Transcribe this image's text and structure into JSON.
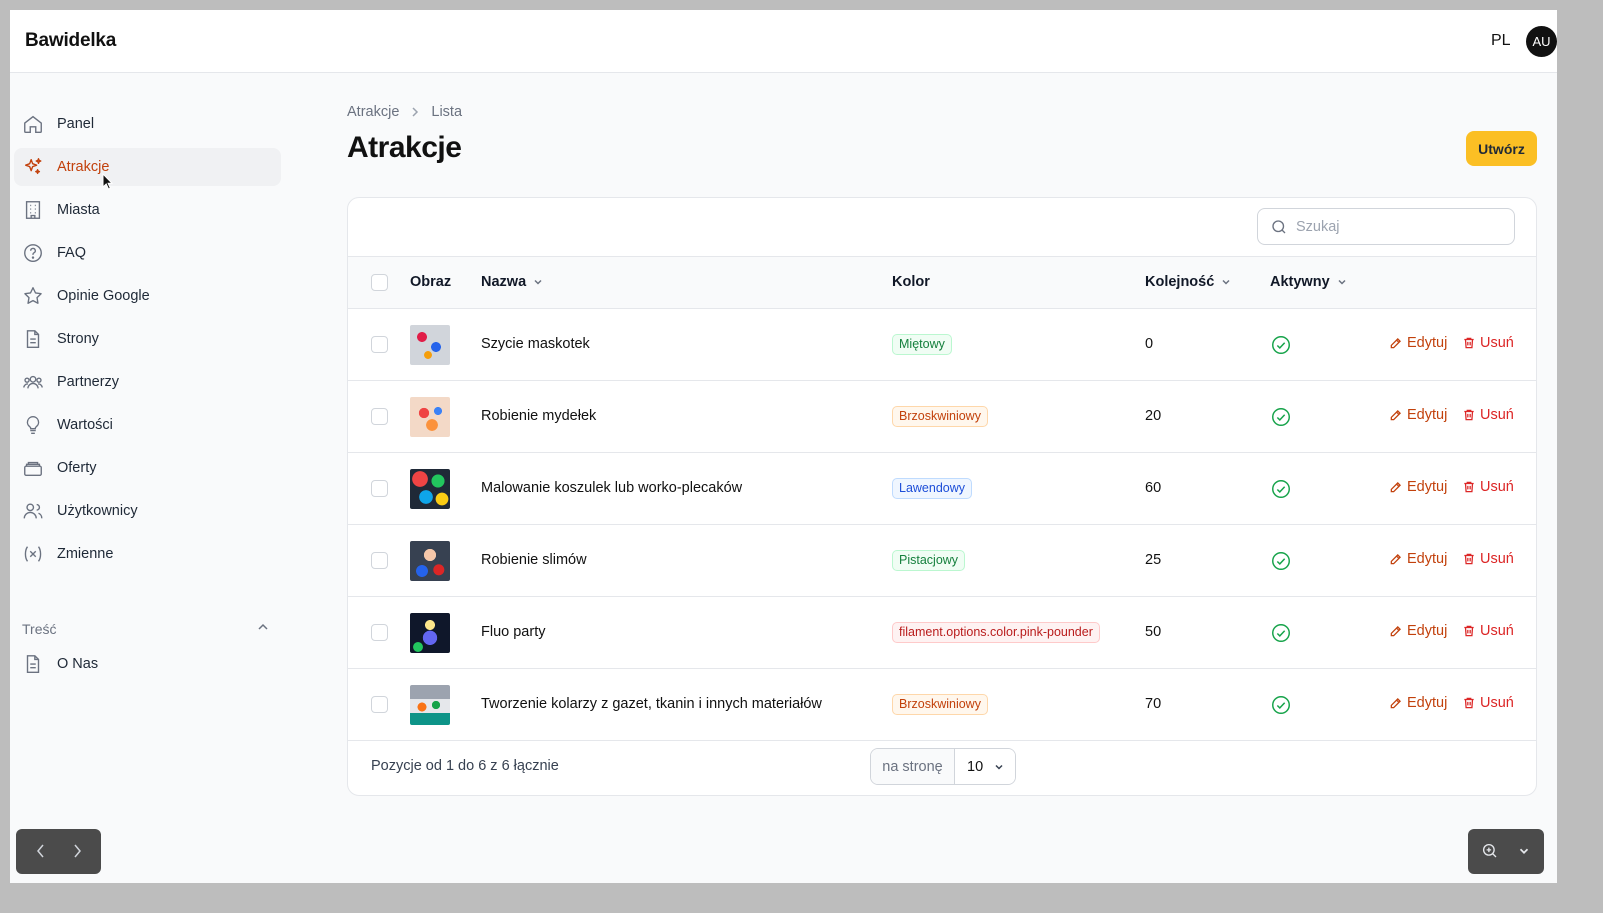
{
  "app": {
    "brand": "Bawidelka",
    "language": "PL",
    "user_initials": "AU"
  },
  "sidebar": {
    "items": [
      {
        "label": "Panel",
        "icon": "home-icon",
        "active": false
      },
      {
        "label": "Atrakcje",
        "icon": "sparkles-icon",
        "active": true
      },
      {
        "label": "Miasta",
        "icon": "building-icon",
        "active": false
      },
      {
        "label": "FAQ",
        "icon": "question-circle-icon",
        "active": false
      },
      {
        "label": "Opinie Google",
        "icon": "star-icon",
        "active": false
      },
      {
        "label": "Strony",
        "icon": "document-icon",
        "active": false
      },
      {
        "label": "Partnerzy",
        "icon": "user-group-icon",
        "active": false
      },
      {
        "label": "Wartości",
        "icon": "lightbulb-icon",
        "active": false
      },
      {
        "label": "Oferty",
        "icon": "stack-icon",
        "active": false
      },
      {
        "label": "Użytkownicy",
        "icon": "users-icon",
        "active": false
      },
      {
        "label": "Zmienne",
        "icon": "variable-icon",
        "active": false
      }
    ],
    "group": {
      "label": "Treść",
      "items": [
        {
          "label": "O Nas",
          "icon": "document-icon"
        }
      ]
    }
  },
  "breadcrumb": {
    "parent": "Atrakcje",
    "current": "Lista"
  },
  "page": {
    "title": "Atrakcje",
    "create_label": "Utwórz"
  },
  "search": {
    "placeholder": "Szukaj",
    "value": ""
  },
  "table": {
    "columns": {
      "image": "Obraz",
      "name": "Nazwa",
      "color": "Kolor",
      "order": "Kolejność",
      "active": "Aktywny"
    },
    "rows": [
      {
        "name": "Szycie maskotek",
        "color": "Miętowy",
        "color_tone": "green",
        "order": "0",
        "active": true
      },
      {
        "name": "Robienie mydełek",
        "color": "Brzoskwiniowy",
        "color_tone": "orange",
        "order": "20",
        "active": true
      },
      {
        "name": "Malowanie koszulek lub worko-plecaków",
        "color": "Lawendowy",
        "color_tone": "blue",
        "order": "60",
        "active": true
      },
      {
        "name": "Robienie slimów",
        "color": "Pistacjowy",
        "color_tone": "green",
        "order": "25",
        "active": true
      },
      {
        "name": "Fluo party",
        "color": "filament.options.color.pink-pounder",
        "color_tone": "red",
        "order": "50",
        "active": true
      },
      {
        "name": "Tworzenie kolarzy z gazet, tkanin i innych materiałów",
        "color": "Brzoskwiniowy",
        "color_tone": "orange",
        "order": "70",
        "active": true
      }
    ],
    "actions": {
      "edit": "Edytuj",
      "delete": "Usuń"
    },
    "footer": {
      "summary": "Pozycje od 1 do 6 z 6 łącznie",
      "per_page_label": "na stronę",
      "per_page_value": "10"
    }
  },
  "colors": {
    "accent": "#c2410c",
    "create_button": "#fbbf24",
    "success": "#16a34a",
    "danger": "#dc2626"
  }
}
